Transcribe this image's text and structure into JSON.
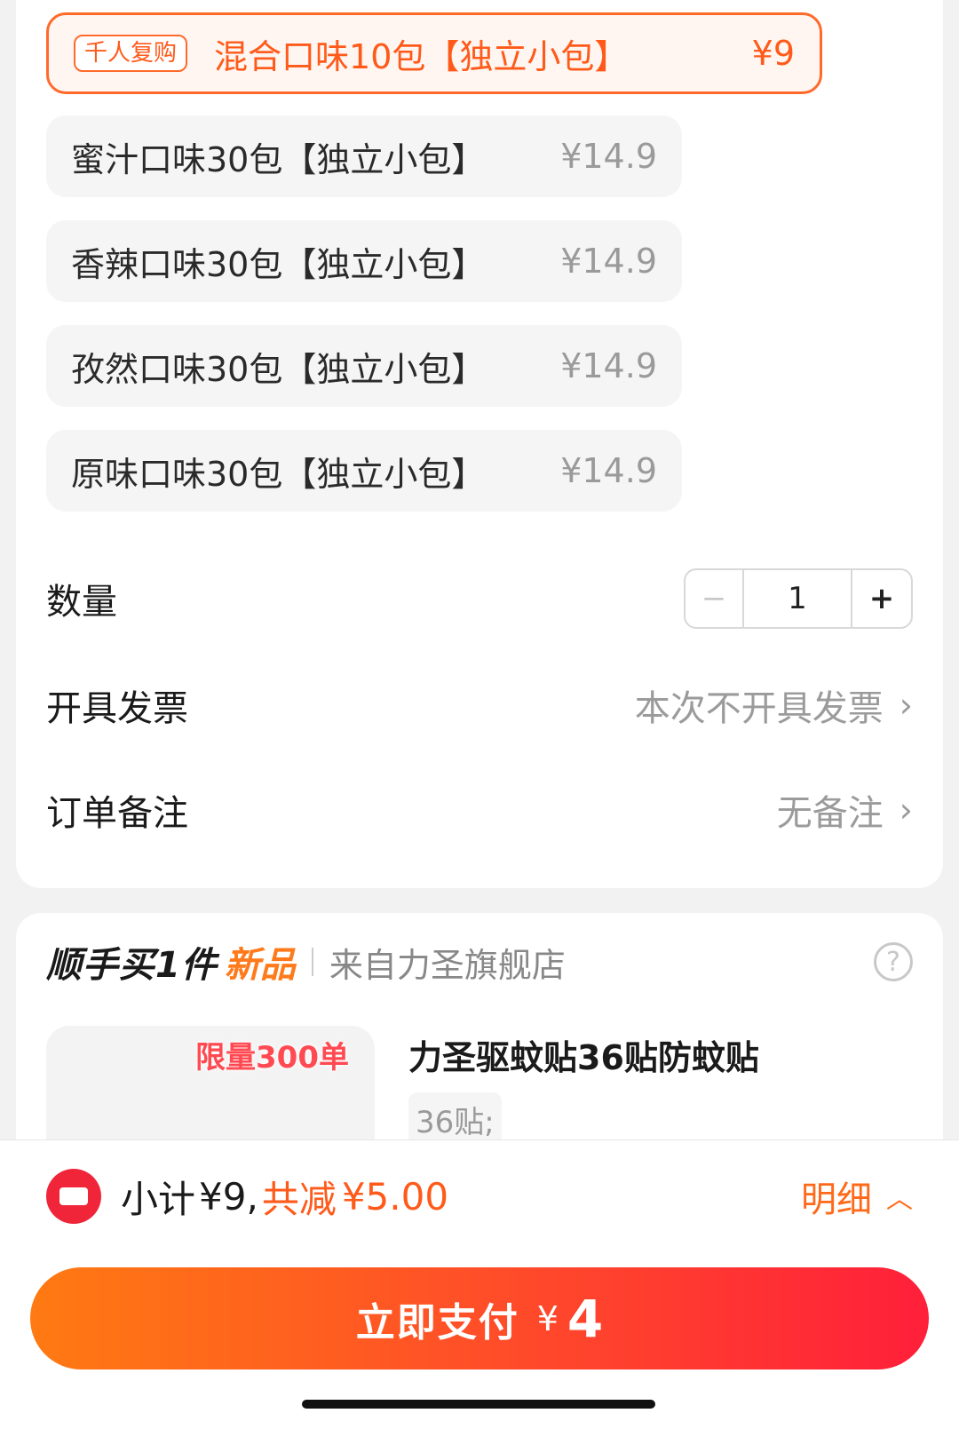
{
  "options": [
    {
      "badge": "千人复购",
      "label": "混合口味10包【独立小包】",
      "price": "¥9",
      "selected": true
    },
    {
      "label": "蜜汁口味30包【独立小包】",
      "price": "¥14.9"
    },
    {
      "label": "香辣口味30包【独立小包】",
      "price": "¥14.9"
    },
    {
      "label": "孜然口味30包【独立小包】",
      "price": "¥14.9"
    },
    {
      "label": "原味口味30包【独立小包】",
      "price": "¥14.9"
    }
  ],
  "quantity": {
    "label": "数量",
    "minus": "−",
    "value": "1",
    "plus": "+"
  },
  "invoice": {
    "label": "开具发票",
    "value": "本次不开具发票"
  },
  "remark": {
    "label": "订单备注",
    "value": "无备注"
  },
  "recommend": {
    "title": "顺手买1件",
    "new_tag": "新品",
    "from": "来自力圣旗舰店",
    "help": "?",
    "product": {
      "tag": "限量300单",
      "name": "力圣驱蚊贴36贴防蚊贴",
      "spec": "36贴;"
    }
  },
  "summary": {
    "subtotal_label": "小计",
    "subtotal_value": "¥9,",
    "discount_label": "共减",
    "discount_value": "¥5.00",
    "detail": "明细"
  },
  "pay": {
    "label": "立即支付",
    "currency": "¥",
    "amount": "4"
  },
  "colors": {
    "accent": "#ff5a1a",
    "pay_start": "#ff7a12",
    "pay_end": "#ff1f3a",
    "coupon": "#f0253a"
  }
}
